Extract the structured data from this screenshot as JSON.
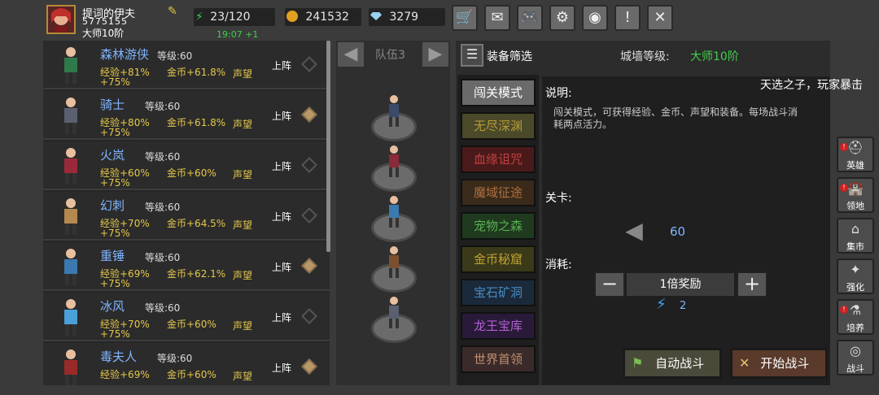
{
  "player": {
    "name": "提词的伊夫",
    "id": "5775155",
    "rank": "大师10阶"
  },
  "stats": {
    "stamina": "23/120",
    "stamina_timer": "19:07 +1",
    "gold": "241532",
    "gems": "3279"
  },
  "toolbar": [
    {
      "name": "shop-icon",
      "glyph": "🛒"
    },
    {
      "name": "mail-icon",
      "glyph": "✉"
    },
    {
      "name": "gamepad-icon",
      "glyph": "🎮"
    },
    {
      "name": "gear-icon",
      "glyph": "⚙"
    },
    {
      "name": "wheel-icon",
      "glyph": "◉"
    },
    {
      "name": "event-icon",
      "glyph": "!"
    },
    {
      "name": "crossed-swords-icon",
      "glyph": "✕"
    }
  ],
  "heroes": [
    {
      "name": "森林游侠",
      "level": "等级:60",
      "exp": "经验+81%",
      "gold": "金币+61.8%",
      "fame": "声望",
      "bonus": "+75%",
      "deploy": "上阵",
      "deployed": false,
      "color": "#2f7a4a"
    },
    {
      "name": "骑士",
      "level": "等级:60",
      "exp": "经验+80%",
      "gold": "金币+61.8%",
      "fame": "声望",
      "bonus": "+75%",
      "deploy": "上阵",
      "deployed": true,
      "color": "#5a6070"
    },
    {
      "name": "火岚",
      "level": "等级:60",
      "exp": "经验+60%",
      "gold": "金币+60%",
      "fame": "声望",
      "bonus": "+75%",
      "deploy": "上阵",
      "deployed": false,
      "color": "#9a2a3a"
    },
    {
      "name": "幻刺",
      "level": "等级:60",
      "exp": "经验+70%",
      "gold": "金币+64.5%",
      "fame": "声望",
      "bonus": "+75%",
      "deploy": "上阵",
      "deployed": false,
      "color": "#b58850"
    },
    {
      "name": "重锤",
      "level": "等级:60",
      "exp": "经验+69%",
      "gold": "金币+62.1%",
      "fame": "声望",
      "bonus": "+75%",
      "deploy": "上阵",
      "deployed": true,
      "color": "#3a7ab0"
    },
    {
      "name": "冰风",
      "level": "等级:60",
      "exp": "经验+70%",
      "gold": "金币+60%",
      "fame": "声望",
      "bonus": "+75%",
      "deploy": "上阵",
      "deployed": false,
      "color": "#4aa0d8"
    },
    {
      "name": "毒夫人",
      "level": "等级:60",
      "exp": "经验+69%",
      "gold": "金币+60%",
      "fame": "声望",
      "bonus": "",
      "deploy": "上阵",
      "deployed": true,
      "color": "#9a2a2a"
    }
  ],
  "team": {
    "title": "队伍3",
    "members": [
      "#3a4a6a",
      "#8a2a3a",
      "#3a7ab0",
      "#7a5030",
      "#5a6070"
    ]
  },
  "panel": {
    "filter_label": "装备筛选",
    "wall_label": "城墙等级:",
    "wall_value": "大师10阶",
    "modes": [
      {
        "label": "闯关模式",
        "bg": "#6a6a6a",
        "fg": "#ffffff"
      },
      {
        "label": "无尽深渊",
        "bg": "#4a4a2a",
        "fg": "#b59a3a"
      },
      {
        "label": "血缘诅咒",
        "bg": "#4a1a1a",
        "fg": "#c04040"
      },
      {
        "label": "魔域征途",
        "bg": "#3a2a1a",
        "fg": "#b07040"
      },
      {
        "label": "宠物之森",
        "bg": "#1f3a1f",
        "fg": "#58b050"
      },
      {
        "label": "金币秘窟",
        "bg": "#3a3a1a",
        "fg": "#c0a030"
      },
      {
        "label": "宝石矿洞",
        "bg": "#1a2a3a",
        "fg": "#4a8ac0"
      },
      {
        "label": "龙王宝库",
        "bg": "#2a1a3a",
        "fg": "#b060d0"
      },
      {
        "label": "世界首领",
        "bg": "#3a2a2a",
        "fg": "#c09070"
      }
    ],
    "desc_title": "说明:",
    "desc_text": "闯关模式，可获得经验、金币、声望和装备。每场战斗消耗两点活力。",
    "stage_title": "关卡:",
    "stage_value": "60",
    "cost_title": "消耗:",
    "multiplier": "1倍奖励",
    "energy_cost": "2",
    "auto_battle": "自动战斗",
    "start_battle": "开始战斗"
  },
  "broadcast": "天选之子，玩家暴击",
  "side_nav": [
    {
      "label": "英雄",
      "icon": "helmet-icon",
      "glyph": "⛑",
      "alert": true
    },
    {
      "label": "领地",
      "icon": "castle-icon",
      "glyph": "🏰",
      "alert": true
    },
    {
      "label": "集市",
      "icon": "market-icon",
      "glyph": "⌂",
      "alert": false
    },
    {
      "label": "强化",
      "icon": "upgrade-icon",
      "glyph": "✦",
      "alert": false
    },
    {
      "label": "培养",
      "icon": "potion-icon",
      "glyph": "⚗",
      "alert": true
    },
    {
      "label": "战斗",
      "icon": "portal-icon",
      "glyph": "◎",
      "alert": false
    }
  ],
  "colors": {
    "accent_green": "#3fd04a",
    "gold_text": "#e6c84a",
    "hero_name": "#7fb4ff"
  }
}
